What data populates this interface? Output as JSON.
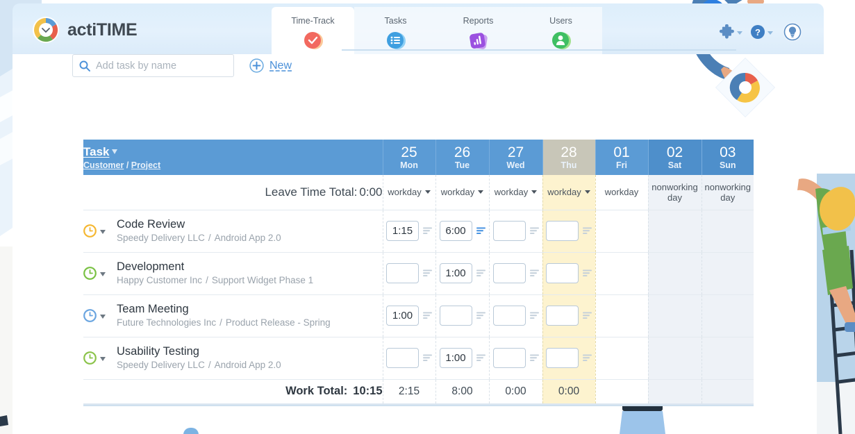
{
  "app": {
    "name": "actiTIME",
    "logo_icon": "clock-donut-logo"
  },
  "nav": {
    "items": [
      {
        "label": "Time-Track",
        "icon": "check-circle-icon",
        "active": true
      },
      {
        "label": "Tasks",
        "icon": "list-icon",
        "active": false
      },
      {
        "label": "Reports",
        "icon": "bar-chart-icon",
        "active": false
      },
      {
        "label": "Users",
        "icon": "user-icon",
        "active": false
      }
    ]
  },
  "topright": {
    "puzzle_icon": "puzzle-icon",
    "help_icon": "question-circle-icon",
    "idea_icon": "lightbulb-icon"
  },
  "toolbar": {
    "search_placeholder": "Add task by name",
    "search_value": "",
    "search_icon": "search-icon",
    "new_icon": "plus-circle-icon",
    "new_label": "New"
  },
  "table": {
    "task_header": "Task",
    "customer_header": "Customer",
    "project_header": "Project",
    "header_separator": "/",
    "sort_icon": "arrow-down-icon",
    "days": [
      {
        "num": "25",
        "name": "Mon",
        "type": "workday",
        "today": false,
        "weekend": false,
        "selectable": true
      },
      {
        "num": "26",
        "name": "Tue",
        "type": "workday",
        "today": false,
        "weekend": false,
        "selectable": true
      },
      {
        "num": "27",
        "name": "Wed",
        "type": "workday",
        "today": false,
        "weekend": false,
        "selectable": true
      },
      {
        "num": "28",
        "name": "Thu",
        "type": "workday",
        "today": true,
        "weekend": false,
        "selectable": true
      },
      {
        "num": "01",
        "name": "Fri",
        "type": "workday",
        "today": false,
        "weekend": false,
        "selectable": false
      },
      {
        "num": "02",
        "name": "Sat",
        "type": "nonworking day",
        "today": false,
        "weekend": true,
        "selectable": false
      },
      {
        "num": "03",
        "name": "Sun",
        "type": "nonworking day",
        "today": false,
        "weekend": true,
        "selectable": false
      }
    ],
    "leave_time_label": "Leave Time Total:",
    "leave_time_total": "0:00",
    "rows": [
      {
        "name": "Code Review",
        "customer": "Speedy Delivery LLC",
        "project": "Android App 2.0",
        "clock_color": "#f5b731",
        "values": [
          "1:15",
          "6:00",
          "",
          "",
          "",
          "",
          ""
        ],
        "notes": [
          false,
          true,
          false,
          false,
          false,
          false,
          false
        ]
      },
      {
        "name": "Development",
        "customer": "Happy Customer Inc",
        "project": "Support Widget Phase 1",
        "clock_color": "#79c143",
        "values": [
          "",
          "1:00",
          "",
          "",
          "",
          "",
          ""
        ],
        "notes": [
          false,
          false,
          false,
          false,
          false,
          false,
          false
        ]
      },
      {
        "name": "Team Meeting",
        "customer": "Future Technologies Inc",
        "project": "Product Release - Spring",
        "clock_color": "#6aa5e0",
        "values": [
          "1:00",
          "",
          "",
          "",
          "",
          "",
          ""
        ],
        "notes": [
          false,
          false,
          false,
          false,
          false,
          false,
          false
        ]
      },
      {
        "name": "Usability Testing",
        "customer": "Speedy Delivery LLC",
        "project": "Android App 2.0",
        "clock_color": "#8bc34a",
        "values": [
          "",
          "1:00",
          "",
          "",
          "",
          "",
          ""
        ],
        "notes": [
          false,
          false,
          false,
          false,
          false,
          false,
          false
        ]
      }
    ],
    "work_total_label": "Work Total:",
    "work_total_value": "10:15",
    "day_totals": [
      "2:15",
      "8:00",
      "0:00",
      "0:00",
      "",
      "",
      ""
    ]
  },
  "colors": {
    "header_blue": "#5b9bd5",
    "today_tan": "#c8c6b8",
    "today_yellow": "#fdf3cf",
    "weekend_gray": "#eef2f7",
    "accent_link": "#4a90d9"
  }
}
